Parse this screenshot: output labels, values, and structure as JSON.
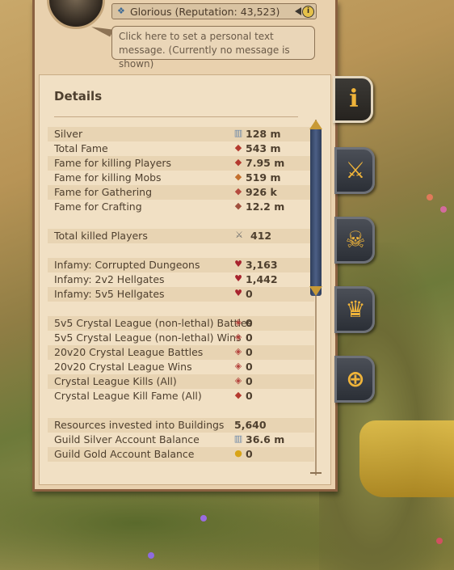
{
  "header": {
    "guild_label": "Glorious (Reputation: 43,523)",
    "message_placeholder": "Click here to set a personal text message. (Currently no message is shown)"
  },
  "details": {
    "title": "Details",
    "rows": [
      {
        "label": "Silver",
        "icon": "silver-icon",
        "value": "128 m"
      },
      {
        "label": "Total Fame",
        "icon": "fame-icon",
        "value": "543 m"
      },
      {
        "label": "Fame for killing Players",
        "icon": "pvp-fame-icon",
        "value": "7.95 m"
      },
      {
        "label": "Fame for killing Mobs",
        "icon": "pve-fame-icon",
        "value": "519 m"
      },
      {
        "label": "Fame for Gathering",
        "icon": "gathering-fame-icon",
        "value": "926 k"
      },
      {
        "label": "Fame for Crafting",
        "icon": "crafting-fame-icon",
        "value": "12.2 m"
      },
      {
        "label": "Total killed Players",
        "icon": "crossed-swords-icon",
        "value": "412"
      },
      {
        "label": "Infamy: Corrupted Dungeons",
        "icon": "infamy-icon",
        "value": "3,163"
      },
      {
        "label": "Infamy: 2v2 Hellgates",
        "icon": "infamy-icon",
        "value": "1,442"
      },
      {
        "label": "Infamy: 5v5 Hellgates",
        "icon": "infamy-icon",
        "value": "0"
      },
      {
        "label": "5v5 Crystal League (non-lethal) Battles",
        "icon": "crystal-icon",
        "value": "0"
      },
      {
        "label": "5v5 Crystal League (non-lethal) Wins",
        "icon": "crystal-icon",
        "value": "0"
      },
      {
        "label": "20v20 Crystal League Battles",
        "icon": "crystal-icon",
        "value": "0"
      },
      {
        "label": "20v20 Crystal League Wins",
        "icon": "crystal-icon",
        "value": "0"
      },
      {
        "label": "Crystal League Kills (All)",
        "icon": "crystal-icon",
        "value": "0"
      },
      {
        "label": "Crystal League Kill Fame (All)",
        "icon": "fame-icon",
        "value": "0"
      },
      {
        "label": "Resources invested into Buildings",
        "icon": "",
        "value": "5,640"
      },
      {
        "label": "Guild Silver Account Balance",
        "icon": "silver-icon",
        "value": "36.6 m"
      },
      {
        "label": "Guild Gold Account Balance",
        "icon": "gold-coin-icon",
        "value": "0"
      }
    ]
  },
  "tabs": [
    {
      "name": "info-tab",
      "icon": "info-icon",
      "active": true
    },
    {
      "name": "combat-tab",
      "icon": "crossed-swords-icon",
      "active": false
    },
    {
      "name": "kills-tab",
      "icon": "skull-crossbones-icon",
      "active": false
    },
    {
      "name": "achievements-tab",
      "icon": "trophy-icon",
      "active": false
    },
    {
      "name": "world-tab",
      "icon": "globe-swords-icon",
      "active": false
    }
  ],
  "colors": {
    "accent": "#f0b43a",
    "panel": "#e9d1ae",
    "scroll_thumb": "#3f5278"
  }
}
